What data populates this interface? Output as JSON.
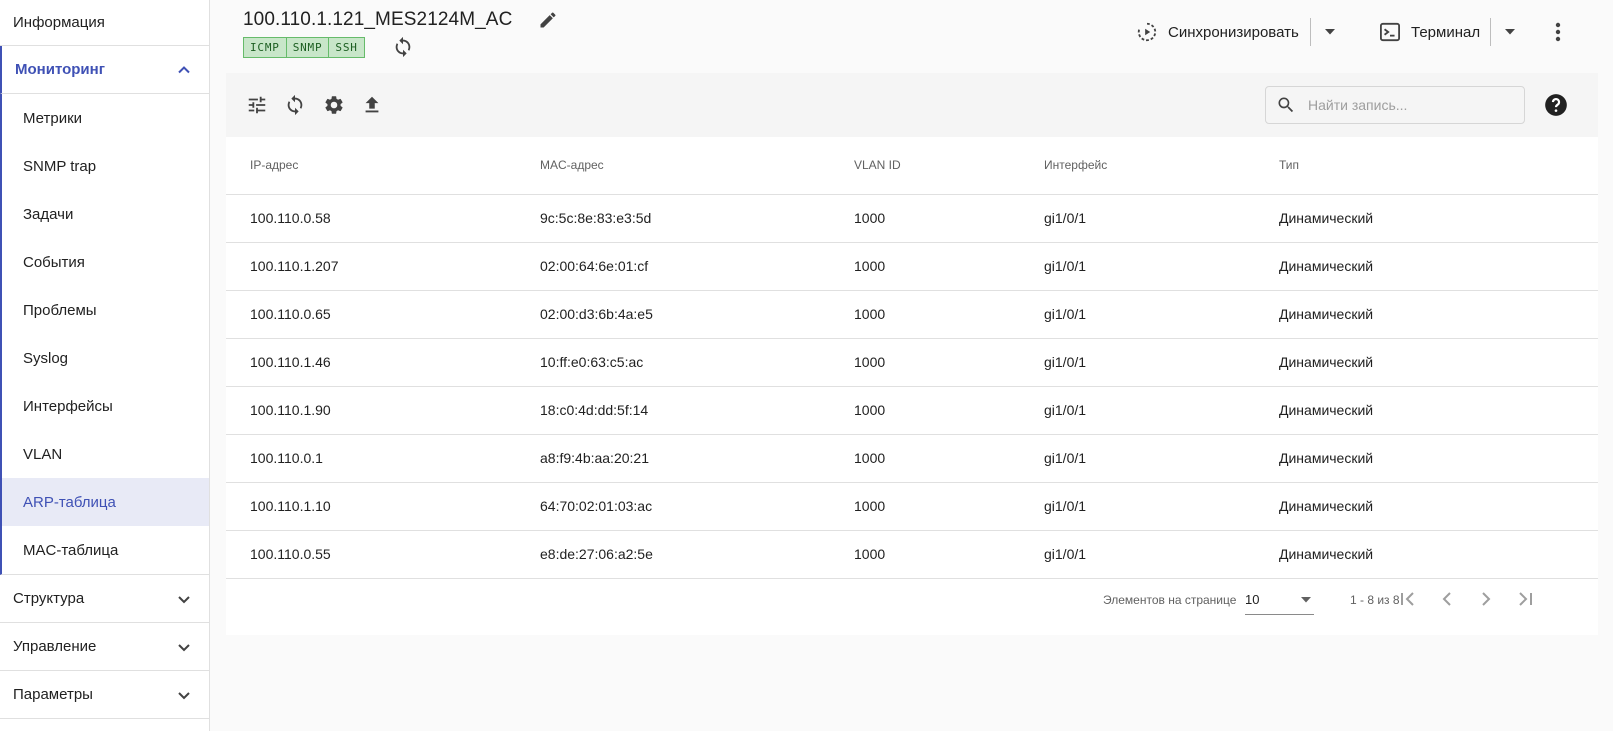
{
  "sidebar": {
    "info": "Информация",
    "monitoring": {
      "label": "Мониторинг",
      "items": [
        "Метрики",
        "SNMP trap",
        "Задачи",
        "События",
        "Проблемы",
        "Syslog",
        "Интерфейсы",
        "VLAN",
        "ARP-таблица",
        "MAC-таблица"
      ],
      "selected": "ARP-таблица"
    },
    "structure": "Структура",
    "management": "Управление",
    "parameters": "Параметры"
  },
  "header": {
    "device_name": "100.110.1.121_MES2124M_AC",
    "protocols": [
      "ICMP",
      "SNMP",
      "SSH"
    ],
    "sync_label": "Синхронизировать",
    "terminal_label": "Терминал"
  },
  "toolbar": {
    "search_placeholder": "Найти запись..."
  },
  "table": {
    "columns": [
      "IP-адрес",
      "MAC-адрес",
      "VLAN ID",
      "Интерфейс",
      "Тип"
    ],
    "rows": [
      [
        "100.110.0.58",
        "9c:5c:8e:83:e3:5d",
        "1000",
        "gi1/0/1",
        "Динамический"
      ],
      [
        "100.110.1.207",
        "02:00:64:6e:01:cf",
        "1000",
        "gi1/0/1",
        "Динамический"
      ],
      [
        "100.110.0.65",
        "02:00:d3:6b:4a:e5",
        "1000",
        "gi1/0/1",
        "Динамический"
      ],
      [
        "100.110.1.46",
        "10:ff:e0:63:c5:ac",
        "1000",
        "gi1/0/1",
        "Динамический"
      ],
      [
        "100.110.1.90",
        "18:c0:4d:dd:5f:14",
        "1000",
        "gi1/0/1",
        "Динамический"
      ],
      [
        "100.110.0.1",
        "a8:f9:4b:aa:20:21",
        "1000",
        "gi1/0/1",
        "Динамический"
      ],
      [
        "100.110.1.10",
        "64:70:02:01:03:ac",
        "1000",
        "gi1/0/1",
        "Динамический"
      ],
      [
        "100.110.0.55",
        "e8:de:27:06:a2:5e",
        "1000",
        "gi1/0/1",
        "Динамический"
      ]
    ]
  },
  "pagination": {
    "per_page_label": "Элементов на странице",
    "per_page_value": "10",
    "range_label": "1 - 8 из 8"
  },
  "colors": {
    "accent": "#3f51b5",
    "selected_bg": "#e8eaf6",
    "badge_bg": "#c8e6c9",
    "badge_border": "#66bb6a"
  }
}
